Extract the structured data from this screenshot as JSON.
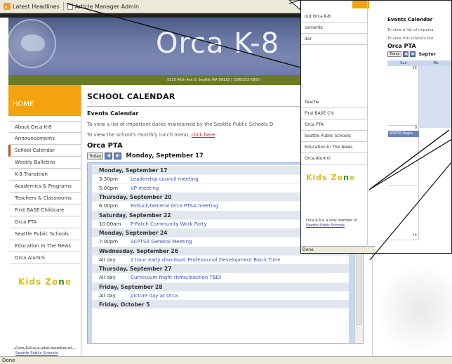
{
  "browser": {
    "bookmarks": [
      {
        "label": "Latest Headlines",
        "icon": "rss-icon"
      },
      {
        "label": "Article Manager Admin",
        "icon": "page-icon"
      }
    ],
    "status": "Done"
  },
  "site": {
    "title": "Orca K-8",
    "address": "5215 46th Ave S. Seattle WA 98118 | (206)252-6900"
  },
  "sidebar": {
    "home": "HOME",
    "items": [
      {
        "label": "About Orca K-8"
      },
      {
        "label": "Announcements"
      },
      {
        "label": "School Calendar",
        "active": true
      },
      {
        "label": "Weekly Bulletins"
      },
      {
        "label": "K-8 Transition"
      },
      {
        "label": "Academics & Programs"
      },
      {
        "label": "Teachers & Classrooms"
      },
      {
        "label": "First BASE Childcare"
      },
      {
        "label": "Orca PTA"
      },
      {
        "label": "Seattle Public Schools"
      },
      {
        "label": "Education In The News"
      },
      {
        "label": "Orca Alumni"
      }
    ],
    "kids_zone": {
      "part1": "Kids Zo",
      "part2": "n",
      "part3": "e"
    },
    "note": {
      "prefix": "Orca K-8 is a vital member of ",
      "link": "Seattle Public Schools",
      "suffix": "."
    }
  },
  "content": {
    "page_title": "SCHOOL CALENDAR",
    "events_heading": "Events Calendar",
    "text1": "To view a list of important dates maintained by the Seattle Public Schools D",
    "text2_prefix": "To view the school's monthly lunch menu, ",
    "text2_link": "click here",
    "text2_suffix": ".",
    "pta_title": "Orca PTA",
    "calendar": {
      "today_label": "Today",
      "prev_icon": "chevron-left-icon",
      "next_icon": "chevron-right-icon",
      "date": "Monday, September 17"
    },
    "agenda": [
      {
        "day": "Monday, September 17",
        "events": [
          {
            "time": "3:30pm",
            "title": "Leadership council meeting"
          },
          {
            "time": "5:00pm",
            "title": "VP meeting"
          }
        ]
      },
      {
        "day": "Thursday, September 20",
        "events": [
          {
            "time": "6:00pm",
            "title": "Potluck/General Orca PTSA meeting"
          }
        ]
      },
      {
        "day": "Saturday, September 22",
        "events": [
          {
            "time": "10:00am",
            "title": "P-Patch Community Work Party"
          }
        ]
      },
      {
        "day": "Monday, September 24",
        "events": [
          {
            "time": "7:00pm",
            "title": "SCPTSA General Meeting"
          }
        ]
      },
      {
        "day": "Wednesday, September 26",
        "events": [
          {
            "time": "All day",
            "title": "2 hour early dismissal: Professional Development Block Time"
          }
        ]
      },
      {
        "day": "Thursday, September 27",
        "events": [
          {
            "time": "All day",
            "title": "Curriculum Night (time/loaction TBD)"
          }
        ]
      },
      {
        "day": "Friday, September 28",
        "events": [
          {
            "time": "All day",
            "title": "picture day at Orca"
          }
        ]
      },
      {
        "day": "Friday, October 5",
        "events": []
      }
    ]
  },
  "inset": {
    "sidebar_items": [
      {
        "label": "out Orca K-8"
      },
      {
        "label": "cements"
      },
      {
        "label": "dar"
      },
      {
        "label": "Teache"
      },
      {
        "label": "First BASE Chi"
      },
      {
        "label": "Orca PTA"
      },
      {
        "label": "Seattle Public Schools"
      },
      {
        "label": "Education In The News"
      },
      {
        "label": "Orca Alumni"
      }
    ],
    "kids_zone": {
      "part1": "Kids Zo",
      "part2": "n",
      "part3": "e"
    },
    "note": {
      "prefix": "Orca K-8 is a vital member of ",
      "link": "Seattle Public Schools",
      "suffix": "."
    },
    "events_heading": "Events Calendar",
    "text1": "To view a list of importa",
    "text2": "To view the school's mo",
    "pta_title": "Orca PTA",
    "today_label": "Today",
    "month": "Septer",
    "weekdays": [
      "Sun",
      "Mo"
    ],
    "day_nums": [
      "26",
      "9",
      "16"
    ],
    "event_label": "WSPTA Regio",
    "status": "Done"
  }
}
